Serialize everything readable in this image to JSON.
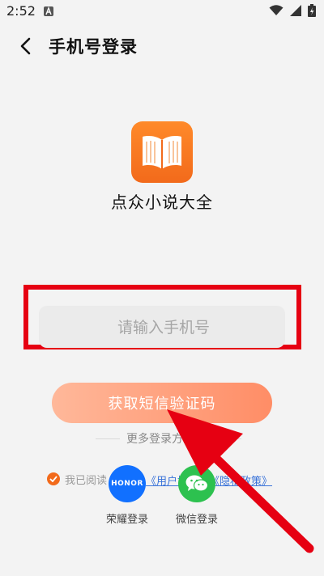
{
  "status_bar": {
    "time": "2:52"
  },
  "header": {
    "title": "手机号登录"
  },
  "app": {
    "name": "点众小说大全"
  },
  "phone_input": {
    "placeholder": "请输入手机号",
    "value": ""
  },
  "sms_button": {
    "label": "获取短信验证码"
  },
  "more_login": {
    "label": "更多登录方式"
  },
  "agreement": {
    "prefix": "我已阅读",
    "user_agreement": "《用户协议》",
    "privacy_policy": "《隐私政策》"
  },
  "login_options": [
    {
      "label": "荣耀登录",
      "logo_text": "HONOR",
      "icon": "honor-icon"
    },
    {
      "label": "微信登录",
      "icon": "wechat-icon"
    }
  ],
  "colors": {
    "accent": "#f26a1b",
    "annotation_red": "#e60012",
    "link": "#3a73d9",
    "honor_blue": "#1170ff",
    "wechat_green": "#2dc14f"
  }
}
